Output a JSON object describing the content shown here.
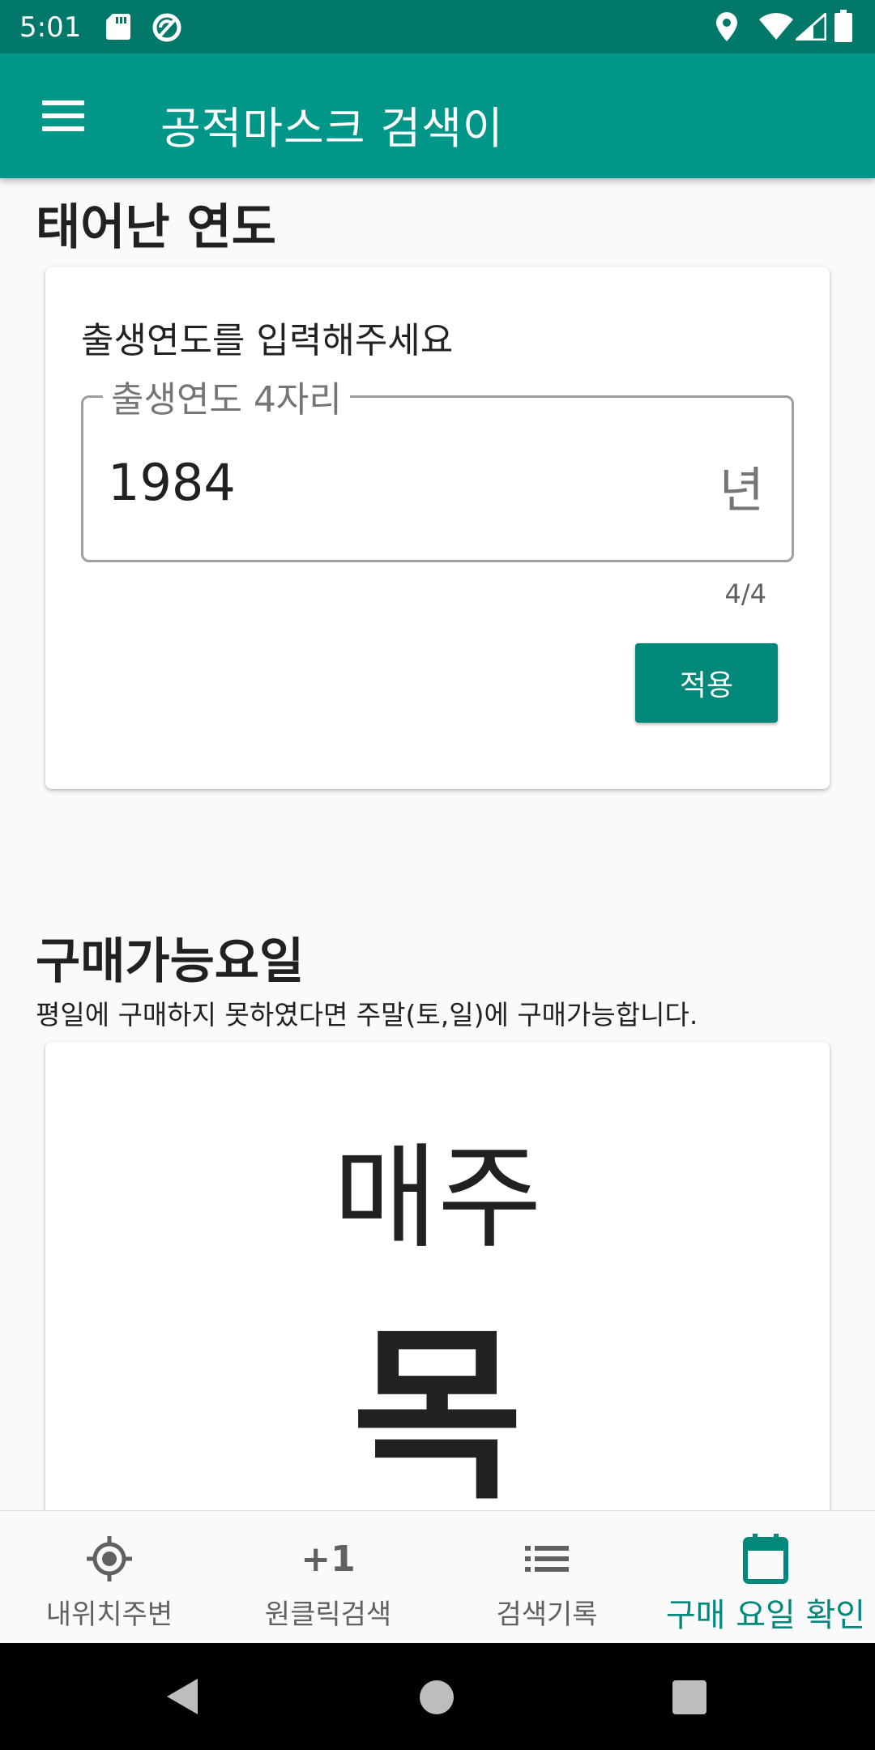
{
  "status_bar": {
    "time": "5:01",
    "icons": [
      "sd-card-icon",
      "sync-icon",
      "location-icon",
      "wifi-icon",
      "signal-icon",
      "battery-icon"
    ]
  },
  "app_bar": {
    "title": "공적마스크 검색이",
    "menu_icon": "menu-icon"
  },
  "birth_year_section": {
    "heading": "태어난 연도",
    "prompt": "출생연도를 입력해주세요",
    "field_label": "출생연도 4자리",
    "field_value": "1984",
    "field_suffix": "년",
    "counter": "4/4",
    "apply_label": "적용"
  },
  "purchase_day_section": {
    "heading": "구매가능요일",
    "description": "평일에 구매하지 못하였다면 주말(토,일)에 구매가능합니다.",
    "weekly_label": "매주",
    "day": "목"
  },
  "bottom_nav": {
    "items": [
      {
        "label": "내위치주변",
        "icon": "my-location-icon",
        "active": false
      },
      {
        "label": "원클릭검색",
        "icon": "plus-one-icon",
        "icon_text": "+1",
        "active": false
      },
      {
        "label": "검색기록",
        "icon": "list-icon",
        "active": false
      },
      {
        "label": "구매 요일 확인",
        "icon": "calendar-icon",
        "active": true
      }
    ]
  },
  "colors": {
    "status_bar": "#00796b",
    "app_bar": "#009688",
    "accent": "#00897b"
  }
}
